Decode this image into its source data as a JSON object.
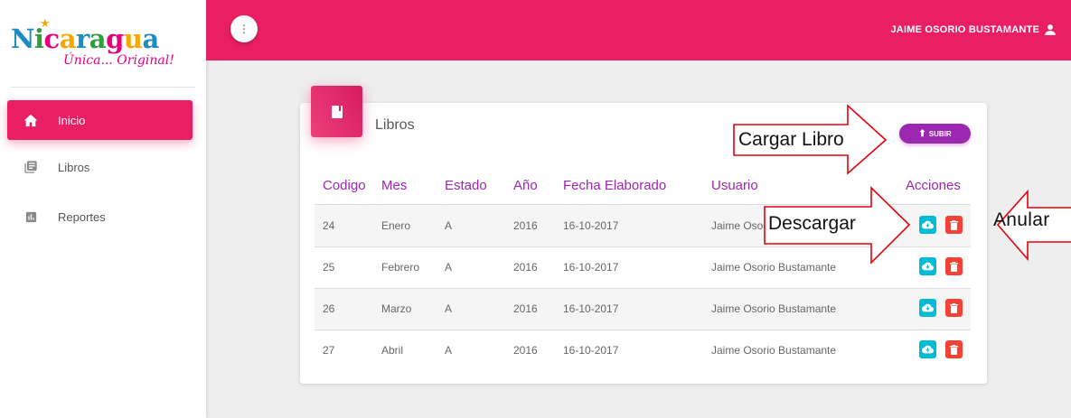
{
  "logo": {
    "main": "Nicaragua",
    "tagline": "Única... Original!"
  },
  "sidebar": {
    "items": [
      {
        "label": "Inicio",
        "icon": "home-icon",
        "active": true
      },
      {
        "label": "Libros",
        "icon": "library-books-icon",
        "active": false
      },
      {
        "label": "Reportes",
        "icon": "assessment-icon",
        "active": false
      }
    ]
  },
  "topbar": {
    "menu_icon": "more-vert-icon",
    "user_name": "JAIME OSORIO BUSTAMANTE",
    "user_icon": "person-icon"
  },
  "card": {
    "icon": "book-icon",
    "title": "Libros",
    "upload_button": "SUBIR",
    "columns": [
      "Codigo",
      "Mes",
      "Estado",
      "Año",
      "Fecha Elaborado",
      "Usuario",
      "Acciones"
    ],
    "rows": [
      {
        "codigo": "24",
        "mes": "Enero",
        "estado": "A",
        "anio": "2016",
        "fecha": "16-10-2017",
        "usuario": "Jaime Osorio Bustamante"
      },
      {
        "codigo": "25",
        "mes": "Febrero",
        "estado": "A",
        "anio": "2016",
        "fecha": "16-10-2017",
        "usuario": "Jaime Osorio Bustamante"
      },
      {
        "codigo": "26",
        "mes": "Marzo",
        "estado": "A",
        "anio": "2016",
        "fecha": "16-10-2017",
        "usuario": "Jaime Osorio Bustamante"
      },
      {
        "codigo": "27",
        "mes": "Abril",
        "estado": "A",
        "anio": "2016",
        "fecha": "16-10-2017",
        "usuario": "Jaime Osorio Bustamante"
      }
    ]
  },
  "annotations": {
    "cargar": "Cargar Libro",
    "descargar": "Descargar",
    "anular": "Anular"
  },
  "colors": {
    "primary": "#e91e63",
    "purple": "#9c27b0",
    "cyan": "#00bcd4",
    "red": "#f44336",
    "annotation_arrow": "#e8000b"
  }
}
